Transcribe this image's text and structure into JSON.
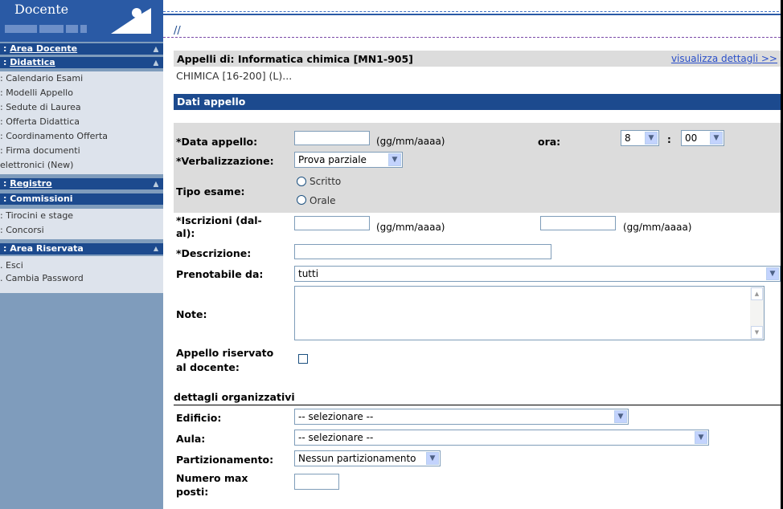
{
  "sidebar": {
    "logo_text": "Docente",
    "area_docente": "Area Docente",
    "didattica": "Didattica",
    "didattica_items": [
      "Calendario Esami",
      "Modelli Appello",
      "Sedute di Laurea",
      "Offerta Didattica",
      "Coordinamento Offerta",
      "Firma documenti",
      "elettronici (New)"
    ],
    "registro": "Registro",
    "commissioni": "Commissioni",
    "commissioni_items": [
      "Tirocini e stage",
      "Concorsi"
    ],
    "area_riservata": "Area Riservata",
    "riservata_items": [
      "Esci",
      "Cambia Password"
    ]
  },
  "breadcrumb": "//",
  "header": {
    "title": "Appelli di: Informatica chimica [MN1-905]",
    "link": "visualizza dettagli >>",
    "subtitle": "CHIMICA [16-200] (L)..."
  },
  "section_title": "Dati appello",
  "form": {
    "data_appello_label": "*Data appello:",
    "date_hint": "(gg/mm/aaaa)",
    "ora_label": "ora:",
    "ora_hour": "8",
    "ora_sep": ":",
    "ora_min": "00",
    "verbalizzazione_label": "*Verbalizzazione:",
    "verbalizzazione_value": "Prova parziale",
    "tipo_esame_label": "Tipo esame:",
    "scritto": "Scritto",
    "orale": "Orale",
    "iscrizioni_label_1": "*Iscrizioni (dal-",
    "iscrizioni_label_2": "al):",
    "descrizione_label": "*Descrizione:",
    "prenotabile_label": "Prenotabile da:",
    "prenotabile_value": "tutti",
    "note_label": "Note:",
    "riservato_label_1": "Appello riservato",
    "riservato_label_2": "al docente:"
  },
  "org": {
    "title": "dettagli organizzativi",
    "edificio_label": "Edificio:",
    "edificio_value": "-- selezionare --",
    "aula_label": "Aula:",
    "aula_value": "-- selezionare --",
    "partizionamento_label": "Partizionamento:",
    "partizionamento_value": "Nessun partizionamento",
    "numero_label_1": "Numero max",
    "numero_label_2": "posti:"
  },
  "colors": {
    "nav_dark": "#1c4a8e",
    "sidebar_bg": "#7f9cbc",
    "form_bg": "#dcdcdc",
    "link": "#2a4fc9"
  }
}
